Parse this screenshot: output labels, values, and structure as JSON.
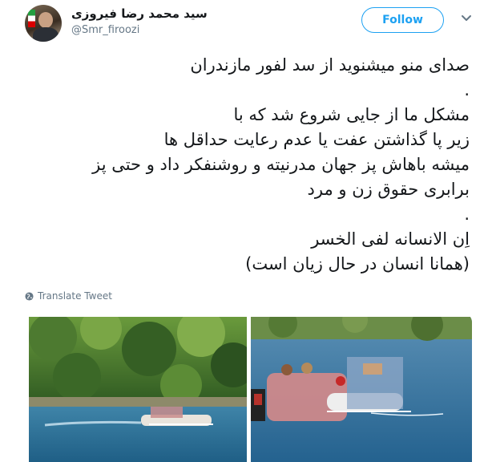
{
  "author": {
    "display_name": "سید محمد رضا فیروزی",
    "handle": "@Smr_firoozi",
    "avatar_icon": "profile-avatar"
  },
  "follow_button": {
    "label": "Follow",
    "color": "#1da1f2"
  },
  "menu_icon": "chevron-down-icon",
  "tweet": {
    "lines": [
      "صدای منو میشنوید از سد لفور مازندران",
      ".",
      "مشکل ما از جایی شروع شد که با",
      "زیر پا گذاشتن عفت یا عدم رعایت حداقل ها",
      "میشه باهاش پز جهان مدرنیته و روشنفکر داد و حتی پز",
      "برابری حقوق زن و مرد",
      ".",
      "اِن الانسانه لفی الخسر",
      "(همانا انسان در حال زیان است)"
    ]
  },
  "translate_label": "Translate Tweet",
  "media": [
    {
      "name": "photo-jetski-lake",
      "icon": "image"
    },
    {
      "name": "photo-boat-passengers",
      "icon": "image"
    }
  ]
}
